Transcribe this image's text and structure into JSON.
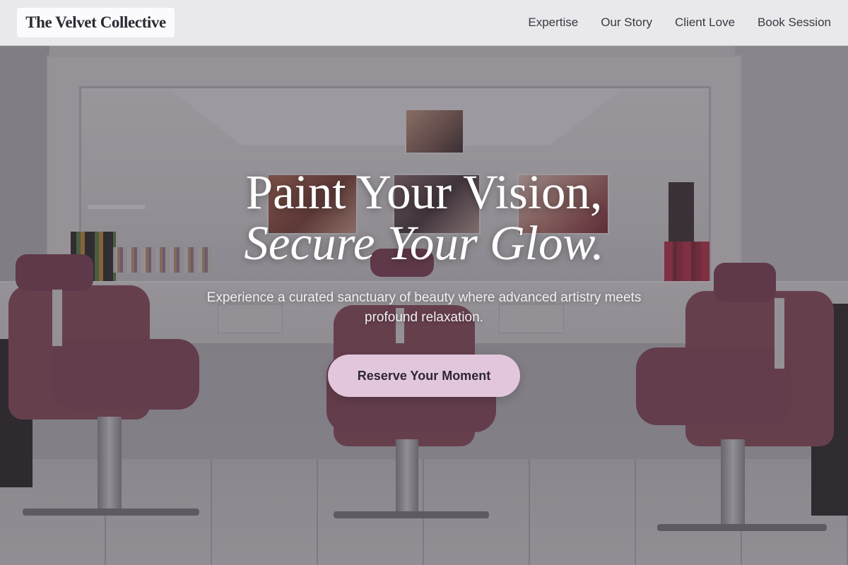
{
  "brand": {
    "name": "The Velvet Collective"
  },
  "nav": {
    "items": [
      {
        "label": "Expertise"
      },
      {
        "label": "Our Story"
      },
      {
        "label": "Client Love"
      },
      {
        "label": "Book Session"
      }
    ]
  },
  "hero": {
    "headline_line1": "Paint Your Vision,",
    "headline_line2": "Secure Your Glow.",
    "subtext": "Experience a curated sanctuary of beauty where advanced artistry meets profound relaxation.",
    "cta_label": "Reserve Your Moment",
    "background_image": "salon-interior-photo"
  },
  "colors": {
    "cta_background": "#e2c7dc",
    "nav_background": "#eeeef0",
    "text_dark": "#2b2a33",
    "chair_accent": "#8a4a5c"
  }
}
